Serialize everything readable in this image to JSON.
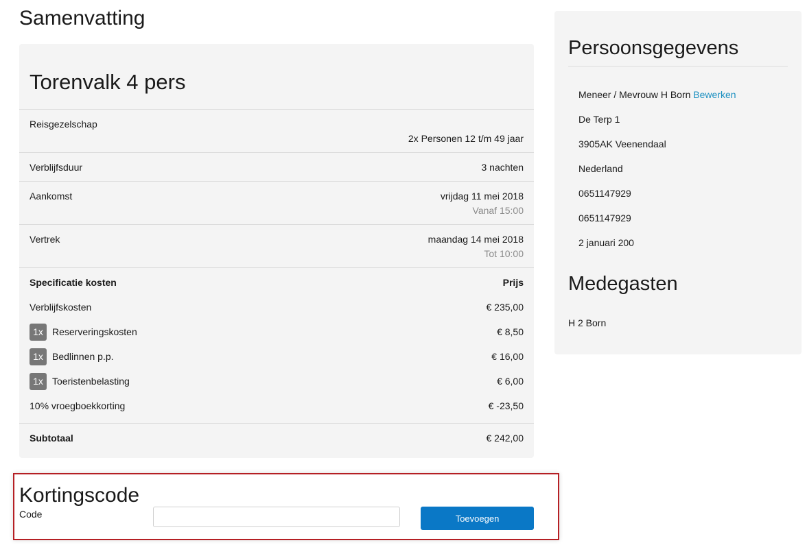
{
  "page_title": "Samenvatting",
  "summary": {
    "title": "Torenvalk 4 pers",
    "party": {
      "label": "Reisgezelschap",
      "value": "2x Personen 12 t/m 49 jaar"
    },
    "duration": {
      "label": "Verblijfsduur",
      "value": "3 nachten"
    },
    "arrival": {
      "label": "Aankomst",
      "value": "vrijdag 11 mei 2018",
      "sub": "Vanaf 15:00"
    },
    "departure": {
      "label": "Vertrek",
      "value": "maandag 14 mei 2018",
      "sub": "Tot 10:00"
    },
    "spec": {
      "header_label": "Specificatie kosten",
      "header_price": "Prijs",
      "lines": [
        {
          "qty": "",
          "name": "Verblijfskosten",
          "price": "€ 235,00"
        },
        {
          "qty": "1x",
          "name": "Reserveringskosten",
          "price": "€ 8,50"
        },
        {
          "qty": "1x",
          "name": "Bedlinnen p.p.",
          "price": "€ 16,00"
        },
        {
          "qty": "1x",
          "name": "Toeristenbelasting",
          "price": "€ 6,00"
        },
        {
          "qty": "",
          "name": "10% vroegboekkorting",
          "price": "€ -23,50"
        }
      ]
    },
    "subtotal": {
      "label": "Subtotaal",
      "value": "€ 242,00"
    }
  },
  "discount": {
    "title": "Kortingscode",
    "code_label": "Code",
    "code_value": "",
    "button_label": "Toevoegen"
  },
  "personal": {
    "title": "Persoonsgegevens",
    "name": "Meneer / Mevrouw H Born",
    "edit_label": "Bewerken",
    "lines": [
      "De Terp 1",
      "3905AK Veenendaal",
      "Nederland",
      "0651147929",
      "0651147929",
      "2 januari 200"
    ]
  },
  "guests": {
    "title": "Medegasten",
    "names": [
      "H 2 Born"
    ]
  },
  "colors": {
    "accent": "#0a78c6",
    "link": "#1a8fc0",
    "highlight_border": "#b51f24",
    "card_bg": "#f4f4f4"
  }
}
